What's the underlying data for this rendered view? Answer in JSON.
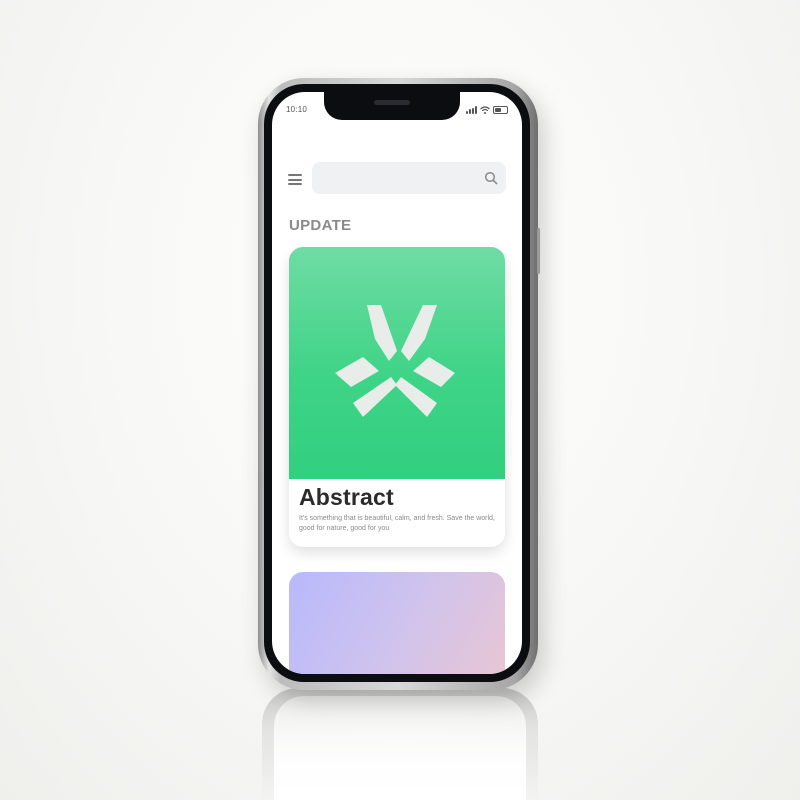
{
  "status_bar": {
    "time": "10:10"
  },
  "search": {
    "value": "",
    "placeholder": ""
  },
  "icons": {
    "menu": "hamburger-menu-icon",
    "search": "search-icon",
    "logo": "abstract-logo-icon",
    "signal": "signal-icon",
    "wifi": "wifi-icon",
    "battery": "battery-icon"
  },
  "main": {
    "section_title": "UPDATE",
    "cards": [
      {
        "title": "Abstract",
        "description": "It's something that is beautiful, calm, and fresh. Save the world, good for nature, good for you",
        "gradient_top": "#6fdca4",
        "gradient_bottom": "#31cf7f"
      },
      {
        "gradient_start": "#b8b9fb",
        "gradient_end": "#e9c6d2"
      }
    ]
  },
  "colors": {
    "accent_green": "#3fd487",
    "title_text": "#2b2b2b",
    "muted_text": "#8a8a8a",
    "phone_bezel": "#0c0d10"
  }
}
